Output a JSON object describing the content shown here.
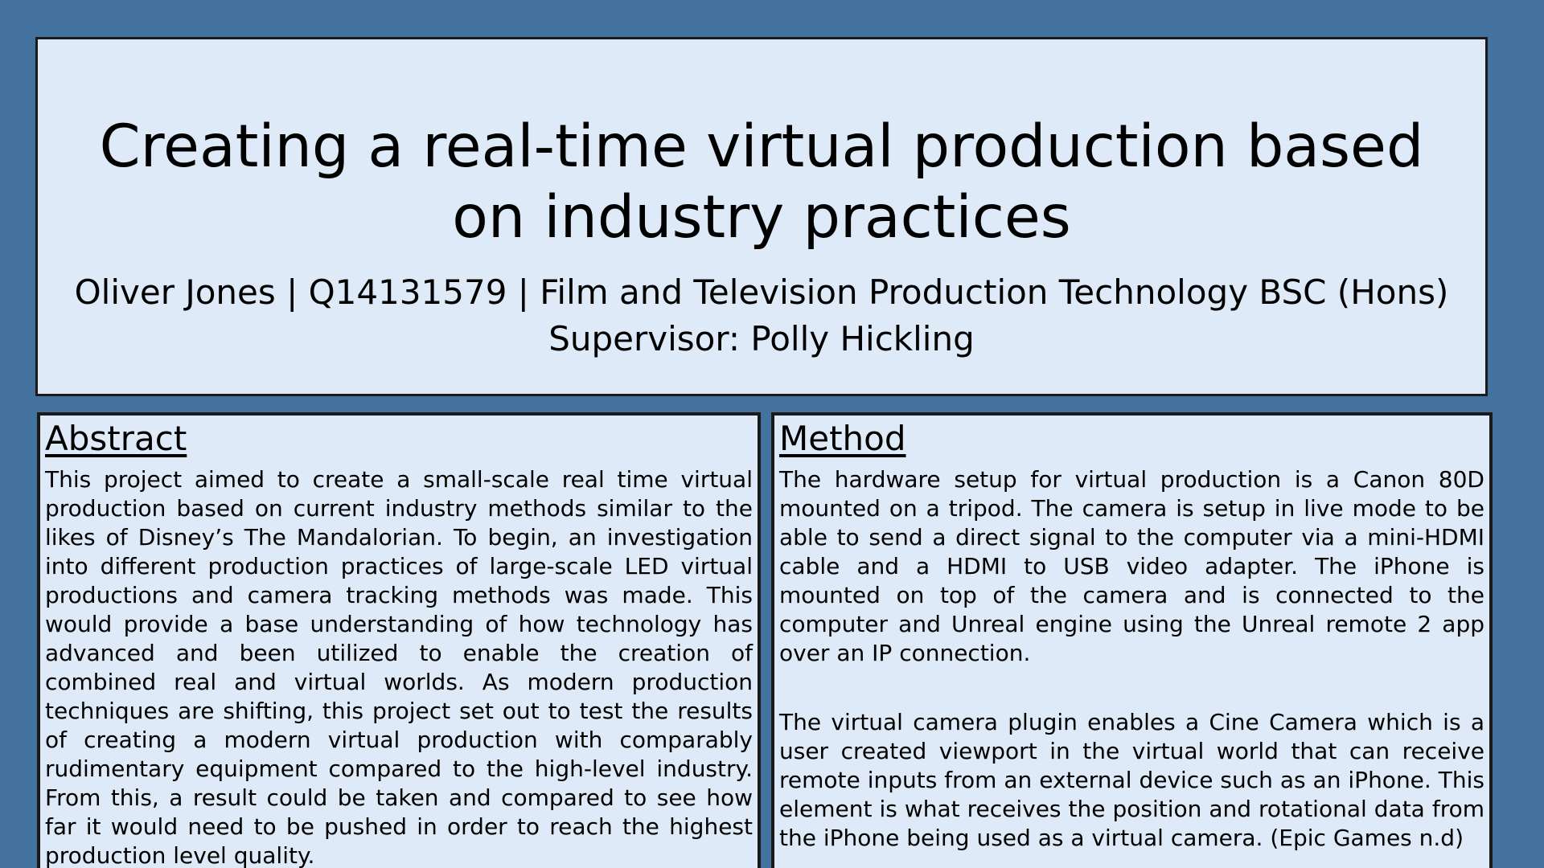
{
  "header": {
    "title": "Creating a real-time virtual production based on industry practices",
    "authors": "Oliver Jones | Q14131579 | Film and Television Production Technology BSC (Hons)",
    "supervisor": "Supervisor: Polly Hickling"
  },
  "abstract": {
    "heading": "Abstract",
    "text": "This project aimed to create a small-scale real time virtual production based on current industry methods similar to the likes of Disney’s The Mandalorian. To begin, an investigation into different production practices of large-scale LED virtual productions and camera tracking methods was made. This would provide a base understanding of how technology has advanced and been utilized to enable the creation of combined real and virtual worlds. As modern production techniques are shifting, this project set out to test the results of creating a modern virtual production with comparably rudimentary equipment compared to the high-level industry. From this, a result could be taken and compared to see how far it would need to be pushed in order to reach the highest production level quality."
  },
  "method": {
    "heading": "Method",
    "paragraphs": [
      "The hardware setup for virtual production is a Canon 80D mounted on a tripod. The camera is setup in live mode to be able to send a direct signal to the computer via a mini-HDMI cable and a HDMI to USB video adapter. The iPhone is mounted on top of the camera and is connected to the computer and Unreal engine using the Unreal remote 2 app over an IP connection.",
      "The virtual camera plugin enables a Cine Camera which is a user created viewport in the virtual world that can receive remote inputs from an external device such as an iPhone. This element is what receives the position and rotational data from the iPhone being used as a virtual camera. (Epic Games n.d)"
    ]
  }
}
